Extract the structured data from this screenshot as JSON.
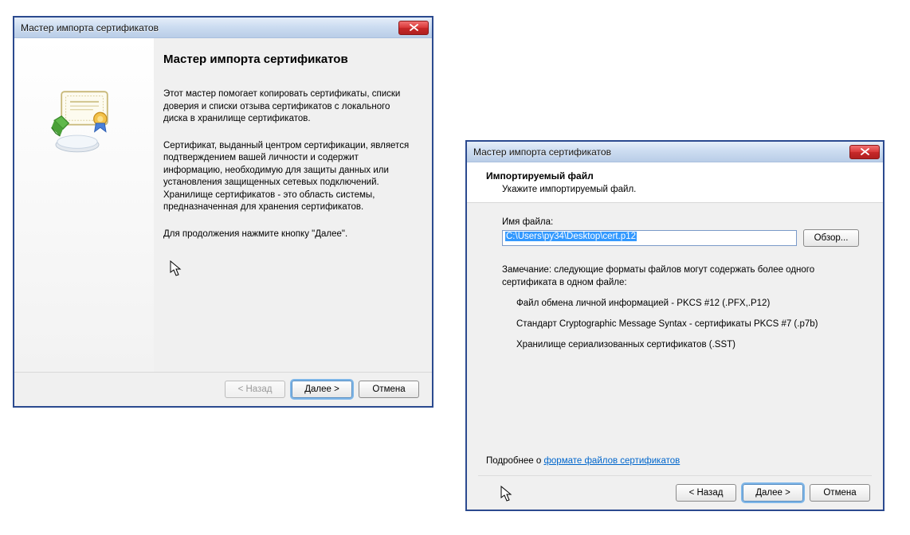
{
  "dialog1": {
    "title": "Мастер импорта сертификатов",
    "heading": "Мастер импорта сертификатов",
    "para1": "Этот мастер помогает копировать сертификаты, списки доверия и списки отзыва сертификатов с локального диска в хранилище сертификатов.",
    "para2": "Сертификат, выданный центром сертификации, является подтверждением вашей личности и содержит информацию, необходимую для защиты данных или установления защищенных сетевых подключений. Хранилище сертификатов - это область системы, предназначенная для хранения сертификатов.",
    "para3": "Для продолжения нажмите кнопку \"Далее\".",
    "buttons": {
      "back": "< Назад",
      "next": "Далее >",
      "cancel": "Отмена"
    }
  },
  "dialog2": {
    "title": "Мастер импорта сертификатов",
    "section_title": "Импортируемый файл",
    "section_sub": "Укажите импортируемый файл.",
    "filename_label": "Имя файла:",
    "filename_value": "C:\\Users\\py34\\Desktop\\cert.p12",
    "browse": "Обзор...",
    "note1": "Замечание: следующие форматы файлов могут содержать более одного сертификата в одном файле:",
    "format1": "Файл обмена личной информацией - PKCS #12 (.PFX,.P12)",
    "format2": "Стандарт Cryptographic Message Syntax - сертификаты PKCS #7 (.p7b)",
    "format3": "Хранилище сериализованных сертификатов (.SST)",
    "more_prefix": "Подробнее о ",
    "more_link": "формате файлов сертификатов",
    "buttons": {
      "back": "< Назад",
      "next": "Далее >",
      "cancel": "Отмена"
    }
  }
}
